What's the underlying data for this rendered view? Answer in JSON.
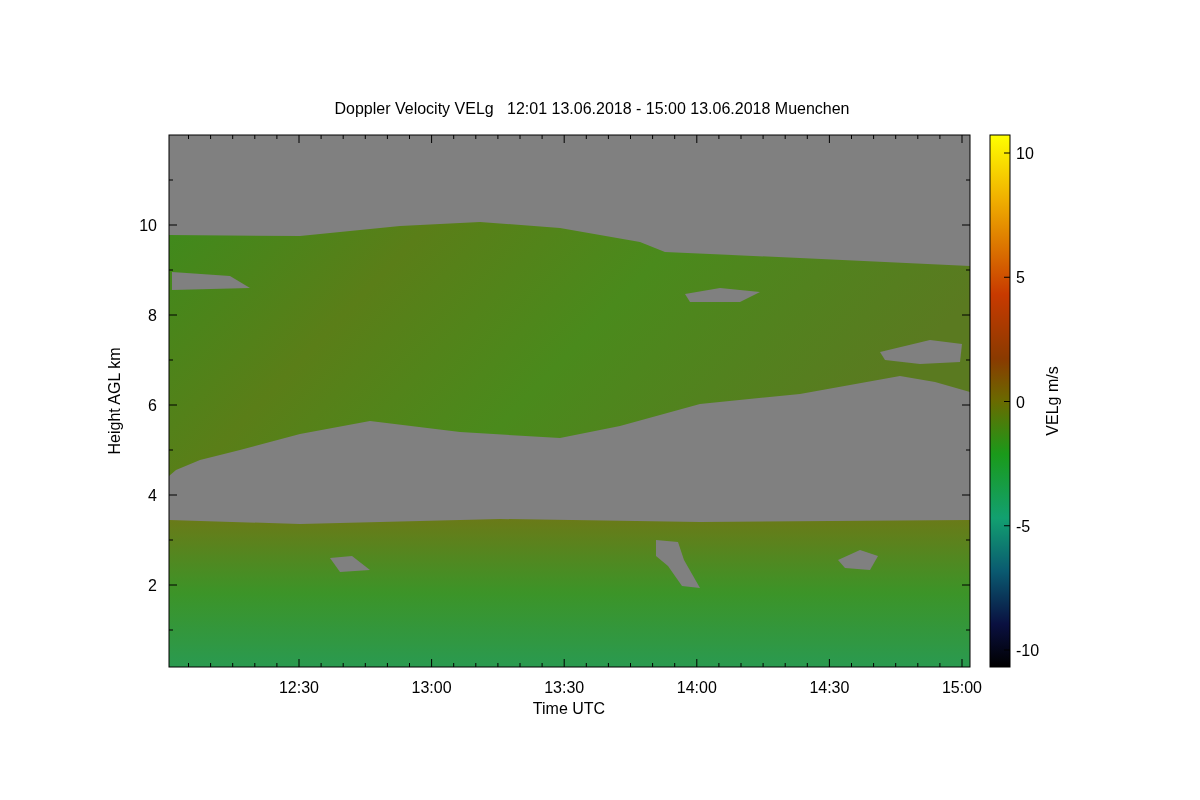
{
  "title": "Doppler Velocity VELg   12:01 13.06.2018 - 15:00 13.06.2018 Muenchen",
  "x_axis": {
    "label": "Time UTC",
    "ticks": [
      "12:30",
      "13:00",
      "13:30",
      "14:00",
      "14:30",
      "15:00"
    ]
  },
  "y_axis": {
    "label": "Height AGL km",
    "ticks": [
      "10",
      "8",
      "6",
      "4",
      "2"
    ]
  },
  "colorbar": {
    "label": "VELg m/s",
    "ticks": [
      "10",
      "5",
      "0",
      "-5",
      "-10"
    ]
  }
}
